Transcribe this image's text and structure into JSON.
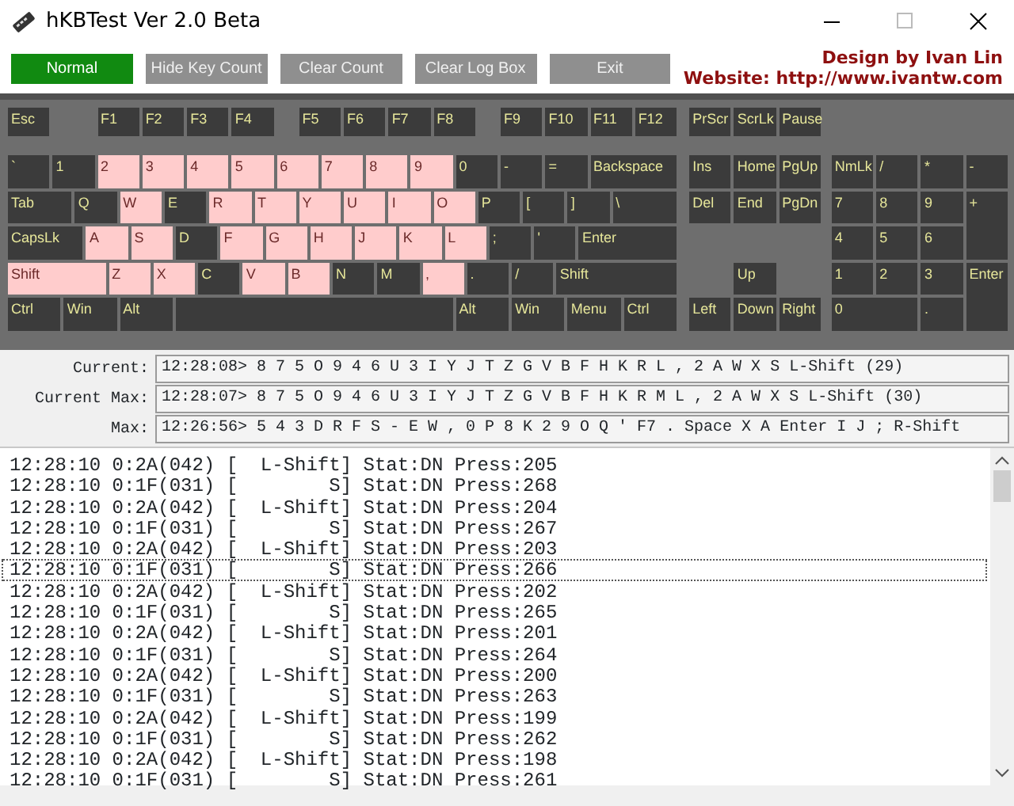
{
  "window": {
    "title": "hKBTest Ver 2.0 Beta"
  },
  "toolbar": {
    "buttons": [
      {
        "label": "Normal",
        "disabled": false
      },
      {
        "label": "Hide Key Count",
        "disabled": true
      },
      {
        "label": "Clear Count",
        "disabled": true
      },
      {
        "label": "Clear Log Box",
        "disabled": true
      },
      {
        "label": "Exit",
        "disabled": true
      }
    ],
    "credits": [
      "Design by Ivan Lin",
      "Website: http://www.ivantw.com"
    ]
  },
  "keyboard": {
    "main": [
      [
        {
          "label": "Esc",
          "pressed": false
        },
        {
          "label": "F1",
          "pressed": false
        },
        {
          "label": "F2",
          "pressed": false
        },
        {
          "label": "F3",
          "pressed": false
        },
        {
          "label": "F4",
          "pressed": false
        },
        {
          "label": "F5",
          "pressed": false
        },
        {
          "label": "F6",
          "pressed": false
        },
        {
          "label": "F7",
          "pressed": false
        },
        {
          "label": "F8",
          "pressed": false
        },
        {
          "label": "F9",
          "pressed": false
        },
        {
          "label": "F10",
          "pressed": false
        },
        {
          "label": "F11",
          "pressed": false
        },
        {
          "label": "F12",
          "pressed": false
        }
      ],
      [
        {
          "label": "`",
          "pressed": false
        },
        {
          "label": "1",
          "pressed": false
        },
        {
          "label": "2",
          "pressed": true
        },
        {
          "label": "3",
          "pressed": true
        },
        {
          "label": "4",
          "pressed": true
        },
        {
          "label": "5",
          "pressed": true
        },
        {
          "label": "6",
          "pressed": true
        },
        {
          "label": "7",
          "pressed": true
        },
        {
          "label": "8",
          "pressed": true
        },
        {
          "label": "9",
          "pressed": true
        },
        {
          "label": "0",
          "pressed": false
        },
        {
          "label": "-",
          "pressed": false
        },
        {
          "label": "=",
          "pressed": false
        },
        {
          "label": "Backspace",
          "pressed": false
        }
      ],
      [
        {
          "label": "Tab",
          "pressed": false
        },
        {
          "label": "Q",
          "pressed": false
        },
        {
          "label": "W",
          "pressed": true
        },
        {
          "label": "E",
          "pressed": false
        },
        {
          "label": "R",
          "pressed": true
        },
        {
          "label": "T",
          "pressed": true
        },
        {
          "label": "Y",
          "pressed": true
        },
        {
          "label": "U",
          "pressed": true
        },
        {
          "label": "I",
          "pressed": true
        },
        {
          "label": "O",
          "pressed": true
        },
        {
          "label": "P",
          "pressed": false
        },
        {
          "label": "[",
          "pressed": false
        },
        {
          "label": "]",
          "pressed": false
        },
        {
          "label": "\\",
          "pressed": false
        }
      ],
      [
        {
          "label": "CapsLk",
          "pressed": false
        },
        {
          "label": "A",
          "pressed": true
        },
        {
          "label": "S",
          "pressed": true
        },
        {
          "label": "D",
          "pressed": false
        },
        {
          "label": "F",
          "pressed": true
        },
        {
          "label": "G",
          "pressed": true
        },
        {
          "label": "H",
          "pressed": true
        },
        {
          "label": "J",
          "pressed": true
        },
        {
          "label": "K",
          "pressed": true
        },
        {
          "label": "L",
          "pressed": true
        },
        {
          "label": ";",
          "pressed": false
        },
        {
          "label": "'",
          "pressed": false
        },
        {
          "label": "Enter",
          "pressed": false
        }
      ],
      [
        {
          "label": "Shift",
          "pressed": true
        },
        {
          "label": "Z",
          "pressed": true
        },
        {
          "label": "X",
          "pressed": true
        },
        {
          "label": "C",
          "pressed": false
        },
        {
          "label": "V",
          "pressed": true
        },
        {
          "label": "B",
          "pressed": true
        },
        {
          "label": "N",
          "pressed": false
        },
        {
          "label": "M",
          "pressed": false
        },
        {
          "label": ",",
          "pressed": true
        },
        {
          "label": ".",
          "pressed": false
        },
        {
          "label": "/",
          "pressed": false
        },
        {
          "label": "Shift",
          "pressed": false
        }
      ],
      [
        {
          "label": "Ctrl",
          "pressed": false
        },
        {
          "label": "Win",
          "pressed": false
        },
        {
          "label": "Alt",
          "pressed": false
        },
        {
          "pressed": false
        },
        {
          "label": "Alt",
          "pressed": false
        },
        {
          "label": "Win",
          "pressed": false
        },
        {
          "label": "Menu",
          "pressed": false
        },
        {
          "label": "Ctrl",
          "pressed": false
        }
      ]
    ],
    "navigation": [
      [
        {
          "label": "PrScr",
          "pressed": false
        },
        {
          "label": "ScrLk",
          "pressed": false
        },
        {
          "label": "Pause",
          "pressed": false
        }
      ],
      [
        {
          "label": "Ins",
          "pressed": false
        },
        {
          "label": "Home",
          "pressed": false
        },
        {
          "label": "PgUp",
          "pressed": false
        }
      ],
      [
        {
          "label": "Del",
          "pressed": false
        },
        {
          "label": "End",
          "pressed": false
        },
        {
          "label": "PgDn",
          "pressed": false
        }
      ],
      [
        {
          "label": "Up",
          "pressed": false
        }
      ],
      [
        {
          "label": "Left",
          "pressed": false
        },
        {
          "label": "Down",
          "pressed": false
        },
        {
          "label": "Right",
          "pressed": false
        }
      ]
    ],
    "numpad": [
      [
        {
          "label": "NmLk",
          "pressed": false
        },
        {
          "label": "/",
          "pressed": false
        },
        {
          "label": "*",
          "pressed": false
        },
        {
          "label": "-",
          "pressed": false
        }
      ],
      [
        {
          "label": "7",
          "pressed": false
        },
        {
          "label": "8",
          "pressed": false
        },
        {
          "label": "9",
          "pressed": false
        },
        {
          "label": "+",
          "pressed": false
        }
      ],
      [
        {
          "label": "4",
          "pressed": false
        },
        {
          "label": "5",
          "pressed": false
        },
        {
          "label": "6",
          "pressed": false
        }
      ],
      [
        {
          "label": "1",
          "pressed": false
        },
        {
          "label": "2",
          "pressed": false
        },
        {
          "label": "3",
          "pressed": false
        },
        {
          "label": "Enter",
          "pressed": false
        }
      ],
      [
        {
          "label": "0",
          "pressed": false
        },
        {
          "label": ".",
          "pressed": false
        }
      ]
    ]
  },
  "status": [
    {
      "label": "Current:",
      "value": "12:28:08> 8 7 5 O 9 4 6 U 3 I Y J T Z G V B F H K R L , 2 A W X S L-Shift (29)"
    },
    {
      "label": "Current Max:",
      "value": "12:28:07> 8 7 5 O 9 4 6 U 3 I Y J T Z G V B F H K R M L , 2 A W X S L-Shift (30)"
    },
    {
      "label": "Max:",
      "value": "12:26:56> 5 4 3 D R F S - E W , 0 P 8 K 2 9 O Q ' F7 . Space X A Enter I J ; R-Shift"
    }
  ],
  "log": [
    {
      "text": "12:28:10 0:2A(042) [  L-Shift] Stat:DN Press:205",
      "selected": false
    },
    {
      "text": "12:28:10 0:1F(031) [        S] Stat:DN Press:268",
      "selected": false
    },
    {
      "text": "12:28:10 0:2A(042) [  L-Shift] Stat:DN Press:204",
      "selected": false
    },
    {
      "text": "12:28:10 0:1F(031) [        S] Stat:DN Press:267",
      "selected": false
    },
    {
      "text": "12:28:10 0:2A(042) [  L-Shift] Stat:DN Press:203",
      "selected": false
    },
    {
      "text": "12:28:10 0:1F(031) [        S] Stat:DN Press:266",
      "selected": true
    },
    {
      "text": "12:28:10 0:2A(042) [  L-Shift] Stat:DN Press:202",
      "selected": false
    },
    {
      "text": "12:28:10 0:1F(031) [        S] Stat:DN Press:265",
      "selected": false
    },
    {
      "text": "12:28:10 0:2A(042) [  L-Shift] Stat:DN Press:201",
      "selected": false
    },
    {
      "text": "12:28:10 0:1F(031) [        S] Stat:DN Press:264",
      "selected": false
    },
    {
      "text": "12:28:10 0:2A(042) [  L-Shift] Stat:DN Press:200",
      "selected": false
    },
    {
      "text": "12:28:10 0:1F(031) [        S] Stat:DN Press:263",
      "selected": false
    },
    {
      "text": "12:28:10 0:2A(042) [  L-Shift] Stat:DN Press:199",
      "selected": false
    },
    {
      "text": "12:28:10 0:1F(031) [        S] Stat:DN Press:262",
      "selected": false
    },
    {
      "text": "12:28:10 0:2A(042) [  L-Shift] Stat:DN Press:198",
      "selected": false
    },
    {
      "text": "12:28:10 0:1F(031) [        S] Stat:DN Press:261",
      "selected": false
    }
  ]
}
